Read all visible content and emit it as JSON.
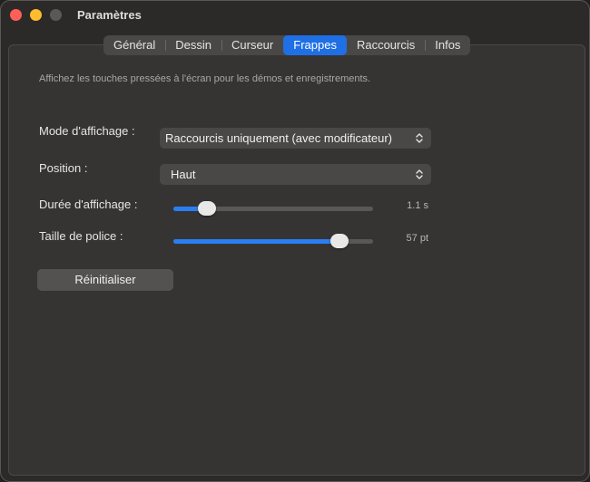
{
  "window": {
    "title": "Paramètres"
  },
  "tabs": [
    {
      "label": "Général",
      "active": false
    },
    {
      "label": "Dessin",
      "active": false
    },
    {
      "label": "Curseur",
      "active": false
    },
    {
      "label": "Frappes",
      "active": true
    },
    {
      "label": "Raccourcis",
      "active": false
    },
    {
      "label": "Infos",
      "active": false
    }
  ],
  "description": "Affichez les touches pressées à l'écran pour les démos et enregistrements.",
  "settings": {
    "display_mode": {
      "label": "Mode d'affichage :",
      "value": "Raccourcis uniquement (avec modificateur)"
    },
    "position": {
      "label": "Position :",
      "value": "Haut"
    },
    "duration": {
      "label": "Durée d'affichage :",
      "value_text": "1.1 s",
      "fraction": 0.17
    },
    "font_size": {
      "label": "Taille de police :",
      "value_text": "57 pt",
      "fraction": 0.83
    }
  },
  "reset_button": "Réinitialiser",
  "colors": {
    "accent": "#1f6fe5",
    "slider_fill": "#2a7ef3",
    "close": "#ff5f57",
    "minimize": "#febc2e"
  },
  "icons": {
    "select_arrows": "chevron-up-down-icon"
  }
}
